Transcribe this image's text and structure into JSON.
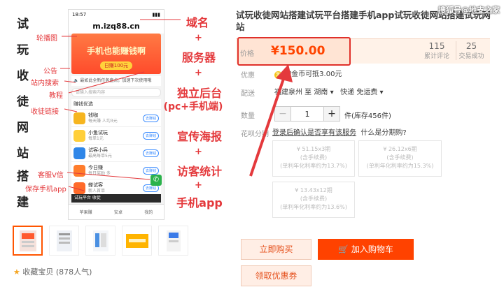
{
  "gallery": {
    "vertical_chars": [
      "试",
      "玩",
      "收",
      "徒",
      "网",
      "站",
      "搭",
      "建"
    ],
    "annotations_left": {
      "carousel": "轮播图",
      "notice": "公告",
      "search": "站内搜索",
      "tutorial": "教程",
      "links": "收徒链接",
      "service": "客服V信",
      "save_app": "保存手机app"
    },
    "features": {
      "domain": "域名",
      "server": "服务器",
      "backend_1": "独立后台",
      "backend_2": "(pc+手机端)",
      "poster": "宣传海报",
      "stats": "访客统计",
      "app": "手机app",
      "plus": "+"
    },
    "phone": {
      "time": "18:57",
      "address": "m.izq88.cn",
      "banner_title": "手机也能赚钱啊",
      "banner_sub": "日赚100元",
      "notice_text": "最如此全新任务盘点，加速下次使用哦",
      "search_placeholder": "请输入搜索内容",
      "section_title": "赚钱优选",
      "apps": [
        {
          "name": "钱咖",
          "desc": "每天赚 人均3元",
          "button": "去赚钱",
          "color": "#f6b51f"
        },
        {
          "name": "小鱼试玩",
          "desc": "每单1元",
          "button": "去赚钱",
          "color": "#ffcf3a"
        },
        {
          "name": "试客小兵",
          "desc": "最高每单5元",
          "button": "去赚钱",
          "color": "#2f86e8"
        },
        {
          "name": "今日赚",
          "desc": "每日奖励 多",
          "button": "去赚钱",
          "color": "#ff7c2b"
        },
        {
          "name": "蝉试客",
          "desc": "新人首单",
          "button": "去赚钱",
          "color": "#ff6a2a"
        }
      ],
      "promo_text": "试玩平台 收徒",
      "tabs": [
        "苹果赚",
        "安卓",
        "我的"
      ]
    },
    "favorite": "收藏宝贝 (878人气)"
  },
  "product": {
    "title": "试玩收徒网站搭建试玩平台搭建手机app试玩收徒网站搭建试玩网站",
    "price_label": "价格",
    "price": "¥150.00",
    "reviews_count": "115",
    "reviews_label": "累计评论",
    "sales_count": "25",
    "sales_label": "交易成功",
    "promo_label": "优惠",
    "promo_text": "淘金币可抵3.00元",
    "shipping_label": "配送",
    "shipping_from": "福建泉州 至",
    "shipping_to": "湖南",
    "shipping_method": "快递 免运费",
    "qty_label": "数量",
    "qty_value": "1",
    "stock": "件(库存456件)",
    "installment_label": "花呗分期",
    "installment_text": "登录后确认是否享有该服务",
    "installment_link": "什么是分期购?",
    "plans": [
      {
        "amount": "¥ 51.15x3期",
        "fee": "(含手续费)",
        "rate": "(单利年化利率约为13.7%)"
      },
      {
        "amount": "¥ 26.12x6期",
        "fee": "(含手续费)",
        "rate": "(单利年化利率约为15.3%)"
      },
      {
        "amount": "¥ 13.43x12期",
        "fee": "(含手续费)",
        "rate": "(单利年化利率约为13.6%)"
      }
    ],
    "buy_now": "立即购买",
    "add_cart": "加入购物车",
    "coupon": "领取优惠券"
  },
  "watermark": "搜狐号@地支之家",
  "colors": {
    "accent": "#ff4400",
    "annotation": "#e4393c"
  }
}
